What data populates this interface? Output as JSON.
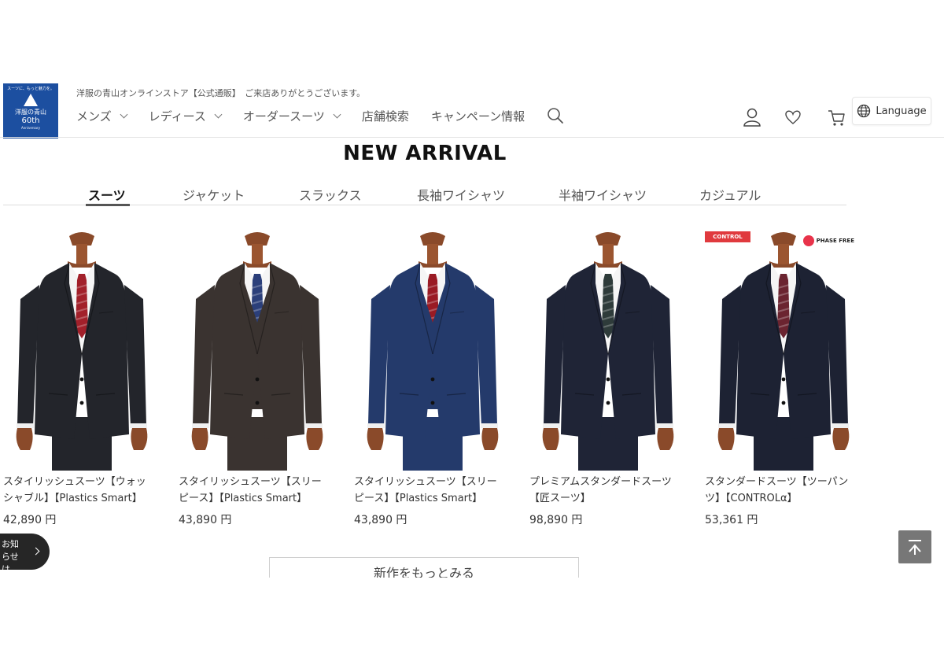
{
  "brand": {
    "logo_tagline": "スーツに、もっと魅力を。",
    "logo_name": "洋服の青山",
    "anniversary": "60th",
    "anniversary_sub": "Anniversary",
    "store_title": "洋服の青山オンラインストア【公式通販】　ご来店ありがとうございます。",
    "brand_color": "#1c4fa0"
  },
  "nav": {
    "items": [
      {
        "label": "メンズ",
        "has_dropdown": true
      },
      {
        "label": "レディース",
        "has_dropdown": true
      },
      {
        "label": "オーダースーツ",
        "has_dropdown": true
      },
      {
        "label": "店舗検索",
        "has_dropdown": false
      },
      {
        "label": "キャンペーン情報",
        "has_dropdown": false
      }
    ],
    "search_icon": "search-icon"
  },
  "header_icons": [
    "user-icon",
    "heart-icon",
    "cart-icon",
    "globe-icon"
  ],
  "language_label": "Language",
  "section": {
    "title": "NEW ARRIVAL",
    "tabs": [
      "スーツ",
      "ジャケット",
      "スラックス",
      "長袖ワイシャツ",
      "半袖ワイシャツ",
      "カジュアル"
    ],
    "active_tab": "スーツ"
  },
  "products": [
    {
      "name": "スタイリッシュスーツ【ウォッシャブル】【Plastics Smart】",
      "price": "42,890 円",
      "color": "#23252b",
      "tie": "#a2202a",
      "three_piece": false
    },
    {
      "name": "スタイリッシュスーツ【スリーピース】【Plastics Smart】",
      "price": "43,890 円",
      "color": "#3a3330",
      "tie": "#2b3f7a",
      "three_piece": true
    },
    {
      "name": "スタイリッシュスーツ【スリーピース】【Plastics Smart】",
      "price": "43,890 円",
      "color": "#243a6b",
      "tie": "#9a1b24",
      "three_piece": true
    },
    {
      "name": "プレミアムスタンダードスーツ【匠スーツ】",
      "price": "98,890 円",
      "color": "#1f2436",
      "tie": "#2e3b3a",
      "three_piece": false
    },
    {
      "name": "スタンダードスーツ【ツーパンツ】【CONTROLα】",
      "price": "53,361 円",
      "color": "#1d2233",
      "tie": "#6b2430",
      "three_piece": false,
      "badges": {
        "control": "CONTROL",
        "phase_free": "PHASE FREE"
      }
    }
  ],
  "more_button": "新作をもっとみる",
  "floating_pill": "お知らせは\nこちら",
  "back_to_top_icon": "back-to-top-icon"
}
